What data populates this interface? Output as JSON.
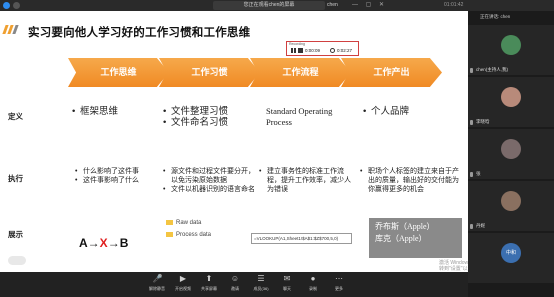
{
  "topbar": {
    "meeting_title": "您正在观看chen的屏幕",
    "user": "chen",
    "window_controls": "— ▢ ✕",
    "clock": "01:01:42"
  },
  "slide": {
    "title": "实习要向他人学习好的工作习惯和工作思维",
    "recording": {
      "label": "Recording",
      "elapsed": "0:00:09",
      "total": "0:02:27"
    },
    "headers": [
      "工作思维",
      "工作习惯",
      "工作流程",
      "工作产出"
    ],
    "rows": {
      "definition": {
        "label": "定义",
        "c1": [
          "框架思维"
        ],
        "c2": [
          "文件整理习惯",
          "文件命名习惯"
        ],
        "c3": [
          "Standard Operating Process"
        ],
        "c4": [
          "个人品牌"
        ]
      },
      "execution": {
        "label": "执行",
        "c1": [
          "什么影响了这件事",
          "这件事影响了什么"
        ],
        "c2": [
          "源文件和过程文件要分开，以免污染原始数据",
          "文件以机器识别的语言命名"
        ],
        "c3": [
          "建立事务性的标准工作流程，提升工作效率，减少人为错误"
        ],
        "c4": [
          "职场个人标签的建立来自于产出的质量，输出好的交付能为你赢得更多的机会"
        ]
      },
      "showcase": {
        "label": "展示",
        "flow_a": "A",
        "flow_arrow1": "→",
        "flow_x": "X",
        "flow_arrow2": "→",
        "flow_b": "B",
        "files": [
          "Raw data",
          "Process data"
        ],
        "formula": "=VLOOKUP(A1,Sheet1!$A$1:$Z$700,5,0)",
        "apple_line1": "乔布斯（Apple）",
        "apple_line2": "库克（Apple）"
      }
    }
  },
  "toolbar": {
    "items": [
      {
        "icon": "microphone-icon",
        "label": "解除静音"
      },
      {
        "icon": "video-icon",
        "label": "开启视频"
      },
      {
        "icon": "share-screen-icon",
        "label": "共享屏幕"
      },
      {
        "icon": "members-icon",
        "label": "邀请"
      },
      {
        "icon": "members-list-icon",
        "label": "成员(36)"
      },
      {
        "icon": "chat-icon",
        "label": "聊天"
      },
      {
        "icon": "record-icon",
        "label": "录制"
      },
      {
        "icon": "more-icon",
        "label": "更多"
      }
    ],
    "watermark_line1": "激活 Windows",
    "watermark_line2": "转到\"设置\"以激活",
    "share_badge": "退出共享"
  },
  "panel": {
    "header": "正在讲话: chen",
    "tiles": [
      {
        "name": "chen(主持人,我)",
        "color": "#4a8b5a"
      },
      {
        "name": "李晓晗",
        "color": "#b88a7a"
      },
      {
        "name": "张",
        "color": "#7a6a6a"
      },
      {
        "name": "丹妮",
        "color": "#8a7060"
      },
      {
        "name": "中和",
        "color": "#3b6fb0"
      }
    ]
  }
}
